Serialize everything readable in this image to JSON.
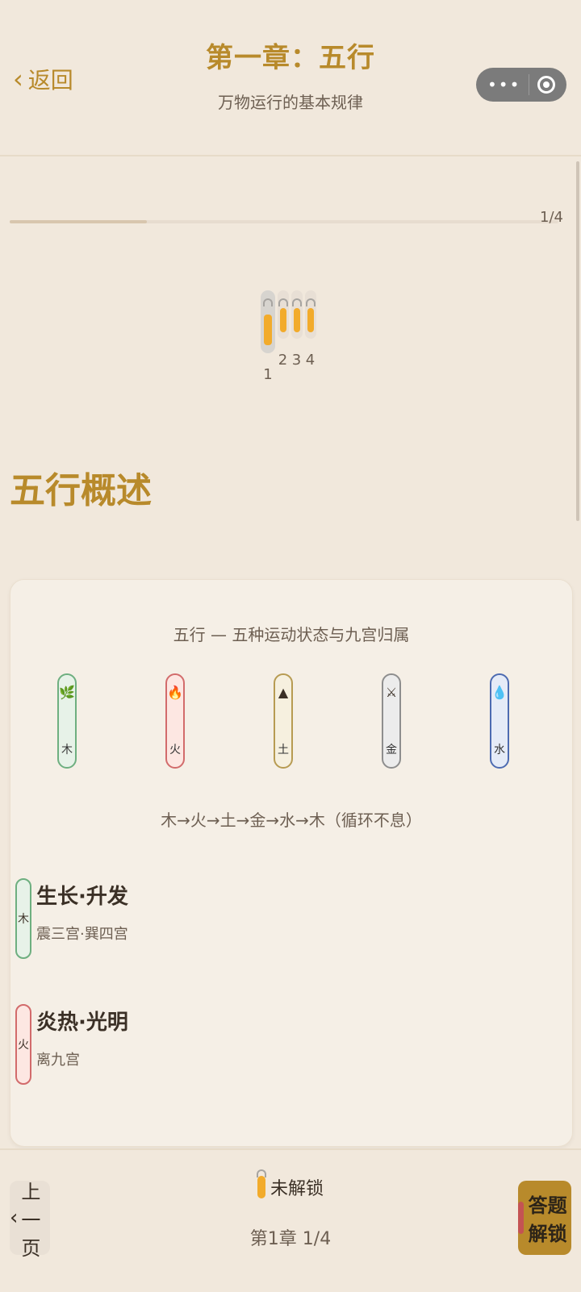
{
  "header": {
    "back_label": "返回",
    "title": "第一章：五行",
    "subtitle": "万物运行的基本规律",
    "capsule_icons": [
      "more-icon",
      "record-icon"
    ]
  },
  "progress": {
    "current": 1,
    "total": 4,
    "text": "1/4"
  },
  "locks": [
    {
      "num": "1",
      "state": "current"
    },
    {
      "num": "2",
      "state": "locked"
    },
    {
      "num": "3",
      "state": "locked"
    },
    {
      "num": "4",
      "state": "locked"
    }
  ],
  "section": {
    "title": "五行概述"
  },
  "card": {
    "title": "五行 — 五种运动状态与九宫归属",
    "elements": [
      {
        "key": "wood",
        "char": "木",
        "icon": "leaf-icon"
      },
      {
        "key": "fire",
        "char": "火",
        "icon": "flame-icon"
      },
      {
        "key": "earth",
        "char": "土",
        "icon": "mountain-icon"
      },
      {
        "key": "metal",
        "char": "金",
        "icon": "swords-icon"
      },
      {
        "key": "water",
        "char": "水",
        "icon": "water-drop-icon"
      }
    ],
    "cycle_text": "木→火→土→金→水→木（循环不息）",
    "list": [
      {
        "title": "生长·升发",
        "subtitle": "震三宫·巽四宫",
        "badge_char": "木",
        "badge_key": "wood"
      },
      {
        "title": "炎热·光明",
        "subtitle": "离九宫",
        "badge_char": "火",
        "badge_key": "fire"
      }
    ]
  },
  "bottom": {
    "prev_label": "上一页",
    "status_label": "未解锁",
    "page_indicator": "第1章 1/4",
    "unlock_label": "答题解锁"
  }
}
